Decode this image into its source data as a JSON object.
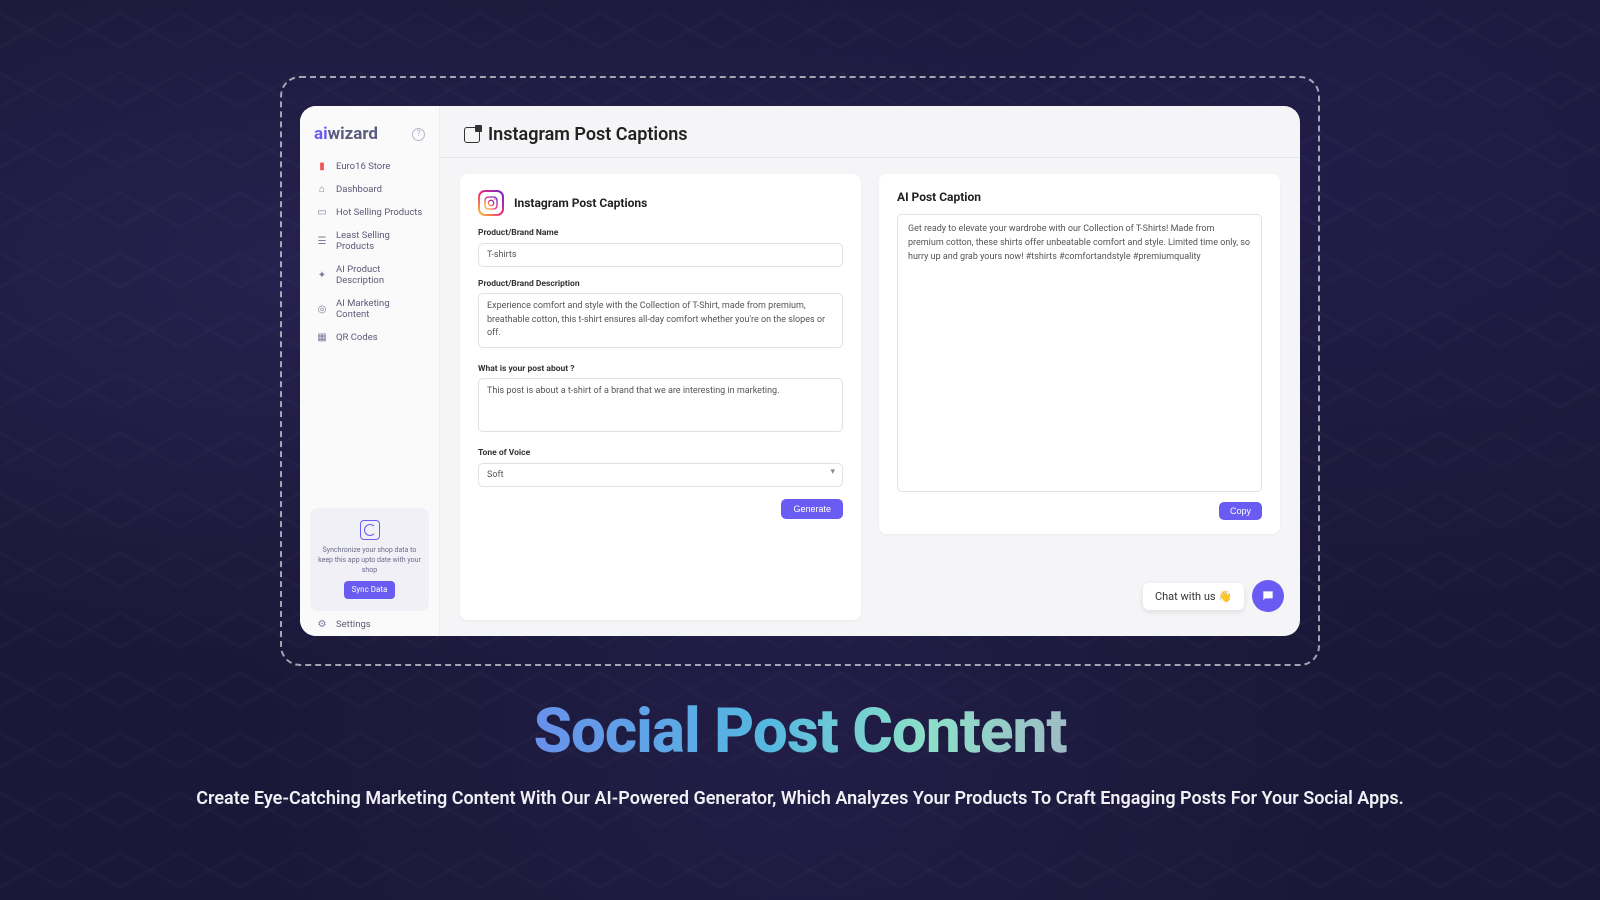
{
  "brand": {
    "ai": "ai",
    "wizard": "wizard"
  },
  "sidebar": {
    "store": "Euro16 Store",
    "items": [
      {
        "icon": "home",
        "label": "Dashboard"
      },
      {
        "icon": "card",
        "label": "Hot Selling Products"
      },
      {
        "icon": "list",
        "label": "Least Selling Products"
      },
      {
        "icon": "spark",
        "label": "AI Product Description"
      },
      {
        "icon": "target",
        "label": "AI Marketing Content"
      },
      {
        "icon": "qr",
        "label": "QR Codes"
      }
    ],
    "sync": {
      "text": "Synchronize your shop data to keep this app upto date with your shop",
      "button": "Sync Data"
    },
    "settings": "Settings"
  },
  "page": {
    "title": "Instagram Post Captions"
  },
  "form": {
    "heading": "Instagram Post Captions",
    "productName": {
      "label": "Product/Brand Name",
      "value": "T-shirts"
    },
    "productDesc": {
      "label": "Product/Brand Description",
      "value": "Experience comfort and style with the Collection of T-Shirt, made from premium, breathable cotton, this t-shirt ensures all-day comfort whether you're on the slopes or off."
    },
    "postAbout": {
      "label": "What is your post about ?",
      "value": "This post is about a t-shirt of a brand that we are interesting in marketing."
    },
    "tone": {
      "label": "Tone of Voice",
      "value": "Soft"
    },
    "generate": "Generate"
  },
  "output": {
    "heading": "AI Post Caption",
    "text": "Get ready to elevate your wardrobe with our Collection of T-Shirts! Made from premium cotton, these shirts offer unbeatable comfort and style. Limited time only, so hurry up and grab yours now! #tshirts #comfortandstyle #premiumquality",
    "copy": "Copy"
  },
  "chat": {
    "label": "Chat with us 👋"
  },
  "hero": {
    "title": "Social Post Content",
    "subtitle": "Create Eye-Catching Marketing Content With Our AI-Powered Generator, Which Analyzes Your Products To Craft Engaging Posts For Your Social Apps."
  }
}
